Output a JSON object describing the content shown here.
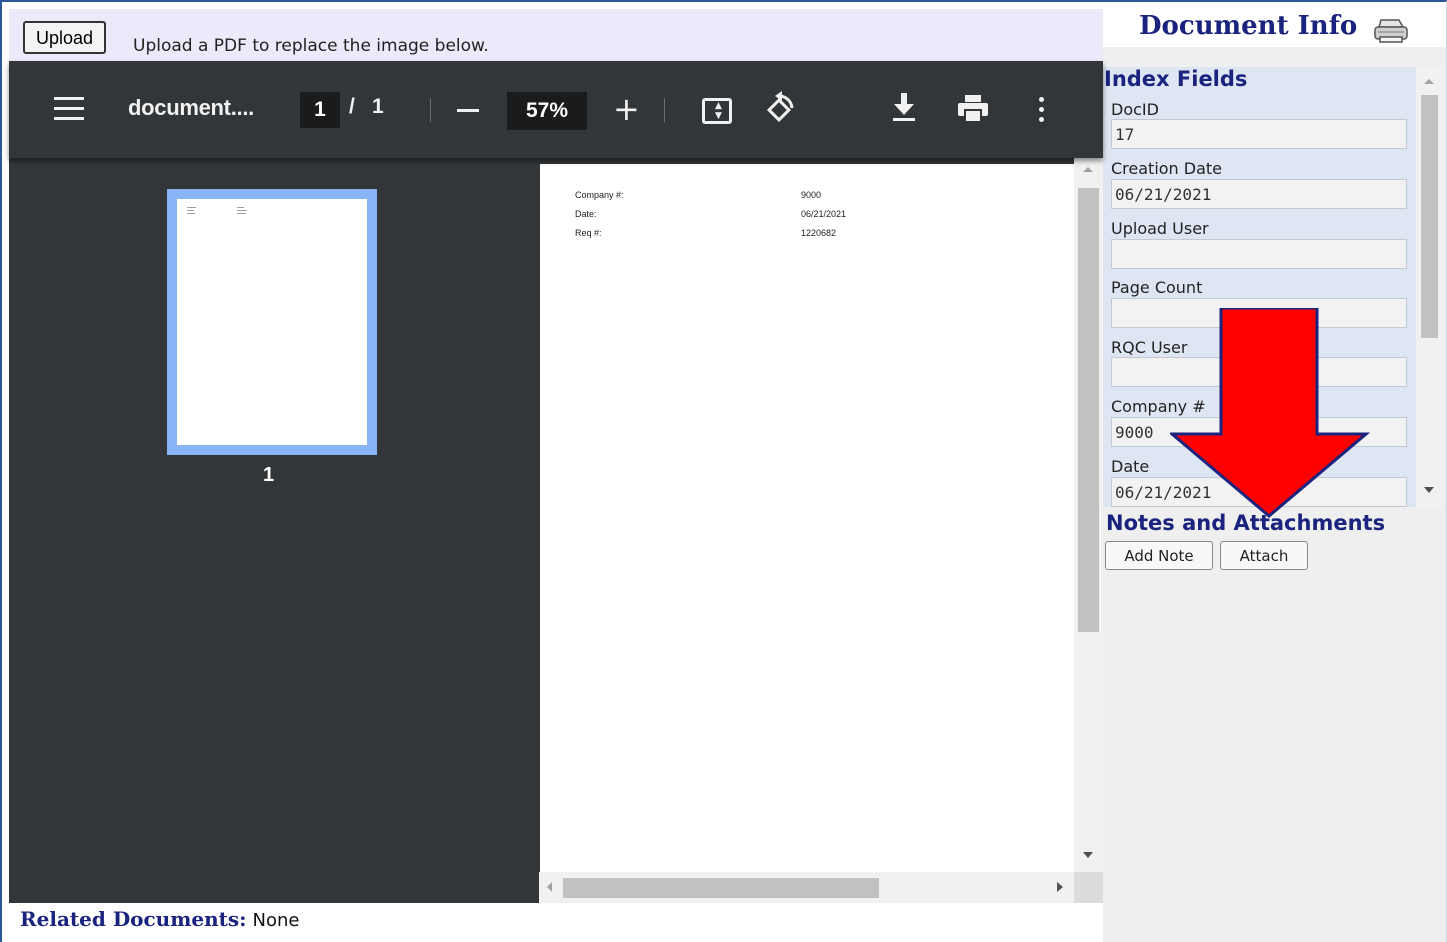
{
  "upload": {
    "button_label": "Upload",
    "hint": "Upload a PDF to replace the image below."
  },
  "viewer": {
    "title": "document....",
    "current_page": "1",
    "separator": "/",
    "total_pages": "1",
    "zoom": "57%",
    "thumbnail_number": "1",
    "page_content": [
      {
        "label": "Company #:",
        "value": "9000"
      },
      {
        "label": "Date:",
        "value": "06/21/2021"
      },
      {
        "label": "Req #:",
        "value": "1220682"
      }
    ]
  },
  "related": {
    "label": "Related Documents:",
    "value": "None"
  },
  "panel": {
    "title": "Document Info",
    "index_title": "Index Fields",
    "fields": [
      {
        "label": "DocID",
        "value": "17"
      },
      {
        "label": "Creation Date",
        "value": "06/21/2021"
      },
      {
        "label": "Upload User",
        "value": ""
      },
      {
        "label": "Page Count",
        "value": ""
      },
      {
        "label": "RQC User",
        "value": ""
      },
      {
        "label": "Company #",
        "value": "9000"
      },
      {
        "label": "Date",
        "value": "06/21/2021"
      }
    ],
    "notes_title": "Notes and Attachments",
    "add_note_label": "Add Note",
    "attach_label": "Attach"
  },
  "colors": {
    "heading_navy": "#1a237e",
    "viewer_dark": "#323639",
    "thumb_highlight": "#8ab4f8",
    "annotation_red": "#ff0000"
  },
  "icons": [
    "menu-icon",
    "fit-page-icon",
    "rotate-icon",
    "download-icon",
    "print-icon",
    "more-vert-icon",
    "printer-icon"
  ]
}
